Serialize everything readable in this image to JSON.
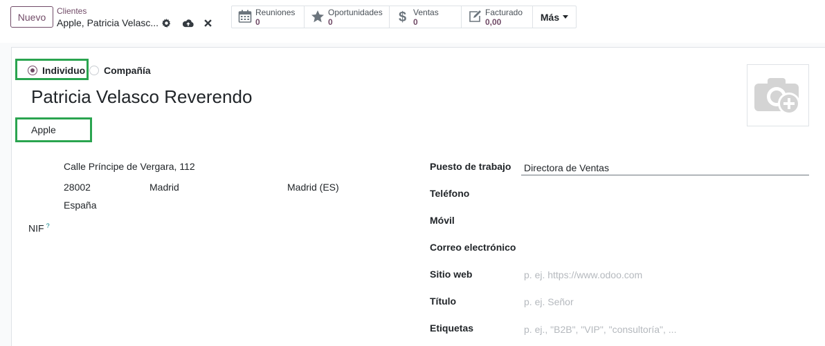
{
  "control_panel": {
    "new_button": "Nuevo",
    "breadcrumb_parent": "Clientes",
    "breadcrumb_current": "Apple, Patricia Velasc...",
    "icons": [
      "gear-icon",
      "cloud-upload-icon",
      "close-icon"
    ]
  },
  "smart_buttons": [
    {
      "icon": "calendar-icon",
      "label": "Reuniones",
      "value": "0"
    },
    {
      "icon": "star-icon",
      "label": "Oportunidades",
      "value": "0"
    },
    {
      "icon": "dollar-icon",
      "label": "Ventas",
      "value": "0"
    },
    {
      "icon": "edit-icon",
      "label": "Facturado",
      "value": "0,00"
    }
  ],
  "more_button": "Más",
  "form": {
    "type_options": [
      {
        "label": "Individuo",
        "checked": true
      },
      {
        "label": "Compañía",
        "checked": false
      }
    ],
    "name": "Patricia Velasco Reverendo",
    "company": "Apple",
    "address": {
      "street": "Calle Príncipe de Vergara, 112",
      "zip": "28002",
      "city": "Madrid",
      "state": "Madrid (ES)",
      "country": "España"
    },
    "vat_label": "NIF",
    "vat_help": "?",
    "fields": {
      "job": {
        "label": "Puesto de trabajo",
        "value": "Directora de Ventas",
        "placeholder": ""
      },
      "phone": {
        "label": "Teléfono",
        "value": "",
        "placeholder": ""
      },
      "mobile": {
        "label": "Móvil",
        "value": "",
        "placeholder": ""
      },
      "email": {
        "label": "Correo electrónico",
        "value": "",
        "placeholder": ""
      },
      "website": {
        "label": "Sitio web",
        "value": "",
        "placeholder": "p. ej. https://www.odoo.com"
      },
      "title": {
        "label": "Título",
        "value": "",
        "placeholder": "p. ej. Señor"
      },
      "tags": {
        "label": "Etiquetas",
        "value": "",
        "placeholder": "p. ej., \"B2B\", \"VIP\", \"consultoría\", ..."
      }
    }
  },
  "colors": {
    "brand": "#714b67",
    "highlight": "#2aa44f",
    "placeholder": "#b5b9be"
  }
}
